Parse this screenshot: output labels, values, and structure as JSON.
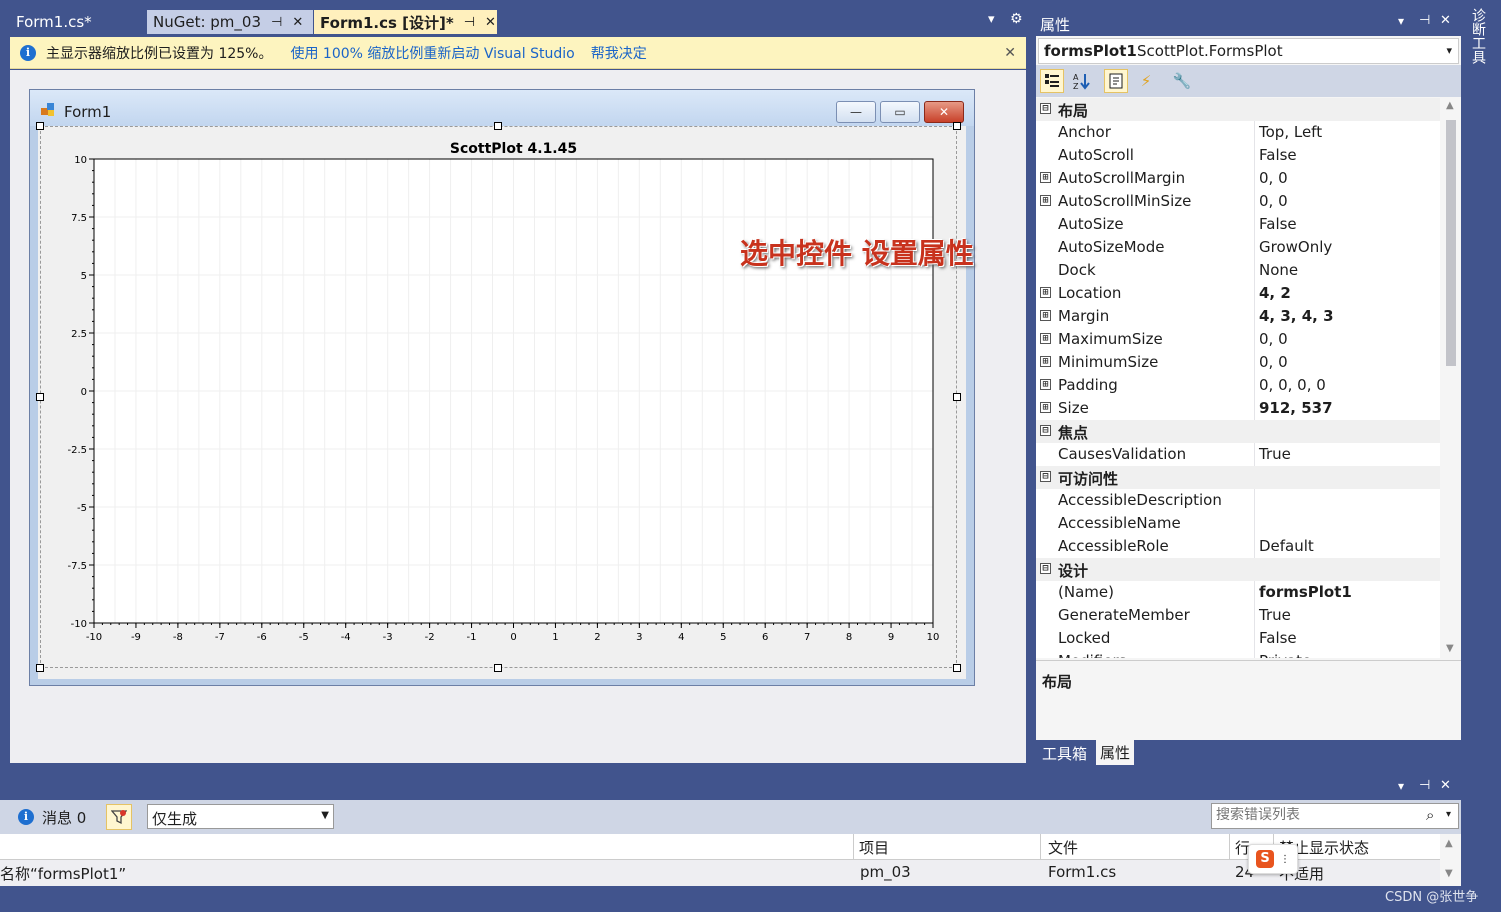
{
  "tabs": [
    {
      "label": "Form1.cs*"
    },
    {
      "label": "NuGet: pm_03",
      "pin": "⊣",
      "close": "✕"
    },
    {
      "label": "Form1.cs [设计]*",
      "pin": "⊣",
      "close": "✕"
    }
  ],
  "tab_overflow": "▾",
  "tab_settings": "⚙",
  "infobar": {
    "icon": "i",
    "message": "主显示器缩放比例已设置为 125%。",
    "link1": "使用 100% 缩放比例重新启动 Visual Studio",
    "link2": "帮我决定",
    "close": "✕"
  },
  "form": {
    "title": "Form1",
    "minimize": "—",
    "maximize": "▭",
    "close": "✕"
  },
  "annotation": "选中控件 设置属性",
  "chart_data": {
    "type": "scatter",
    "title": "ScottPlot 4.1.45",
    "xlabel": "",
    "ylabel": "",
    "xlim": [
      -10,
      10
    ],
    "ylim": [
      -10,
      10
    ],
    "x_ticks": [
      "-10",
      "-9",
      "-8",
      "-7",
      "-6",
      "-5",
      "-4",
      "-3",
      "-2",
      "-1",
      "0",
      "1",
      "2",
      "3",
      "4",
      "5",
      "6",
      "7",
      "8",
      "9",
      "10"
    ],
    "y_ticks": [
      "10",
      "7.5",
      "5",
      "2.5",
      "0",
      "-2.5",
      "-5",
      "-7.5",
      "-10"
    ],
    "series": [],
    "grid": true
  },
  "properties": {
    "panel_title": "属性",
    "panel_controls": [
      "▾",
      "⊣",
      "✕"
    ],
    "object_name": "formsPlot1",
    "object_type": "ScottPlot.FormsPlot",
    "toolbar": [
      "categorized-icon",
      "alphabetical-icon",
      "properties-icon",
      "events-icon",
      "property-pages-icon"
    ],
    "rows": [
      {
        "kind": "cat",
        "name": "布局",
        "expander": "⊟"
      },
      {
        "name": "Anchor",
        "value": "Top, Left"
      },
      {
        "name": "AutoScroll",
        "value": "False"
      },
      {
        "name": "AutoScrollMargin",
        "value": "0, 0",
        "expander": "⊞"
      },
      {
        "name": "AutoScrollMinSize",
        "value": "0, 0",
        "expander": "⊞"
      },
      {
        "name": "AutoSize",
        "value": "False"
      },
      {
        "name": "AutoSizeMode",
        "value": "GrowOnly"
      },
      {
        "name": "Dock",
        "value": "None"
      },
      {
        "name": "Location",
        "value": "4, 2",
        "expander": "⊞",
        "bold": true
      },
      {
        "name": "Margin",
        "value": "4, 3, 4, 3",
        "expander": "⊞",
        "bold": true
      },
      {
        "name": "MaximumSize",
        "value": "0, 0",
        "expander": "⊞"
      },
      {
        "name": "MinimumSize",
        "value": "0, 0",
        "expander": "⊞"
      },
      {
        "name": "Padding",
        "value": "0, 0, 0, 0",
        "expander": "⊞"
      },
      {
        "name": "Size",
        "value": "912, 537",
        "expander": "⊞",
        "bold": true
      },
      {
        "kind": "cat",
        "name": "焦点",
        "expander": "⊟"
      },
      {
        "name": "CausesValidation",
        "value": "True"
      },
      {
        "kind": "cat",
        "name": "可访问性",
        "expander": "⊟"
      },
      {
        "name": "AccessibleDescription",
        "value": ""
      },
      {
        "name": "AccessibleName",
        "value": ""
      },
      {
        "name": "AccessibleRole",
        "value": "Default"
      },
      {
        "kind": "cat",
        "name": "设计",
        "expander": "⊟"
      },
      {
        "name": "(Name)",
        "value": "formsPlot1",
        "bold": true
      },
      {
        "name": "GenerateMember",
        "value": "True"
      },
      {
        "name": "Locked",
        "value": "False"
      },
      {
        "name": "Modifiers",
        "value": "Private"
      }
    ],
    "description_title": "布局",
    "bottom_tabs": [
      "工具箱",
      "属性"
    ]
  },
  "side_tab": "诊断工具",
  "error_list": {
    "controls": [
      "▾",
      "⊣",
      "✕"
    ],
    "messages_label": "消息 0",
    "filter": "仅生成",
    "search_placeholder": "搜索错误列表",
    "columns": [
      "项目",
      "文件",
      "行",
      "禁止显示状态"
    ],
    "row": {
      "desc": "名称“formsPlot1”",
      "project": "pm_03",
      "file": "Form1.cs",
      "line": "24",
      "state": "不适用"
    }
  },
  "watermark": "CSDN @张世争"
}
